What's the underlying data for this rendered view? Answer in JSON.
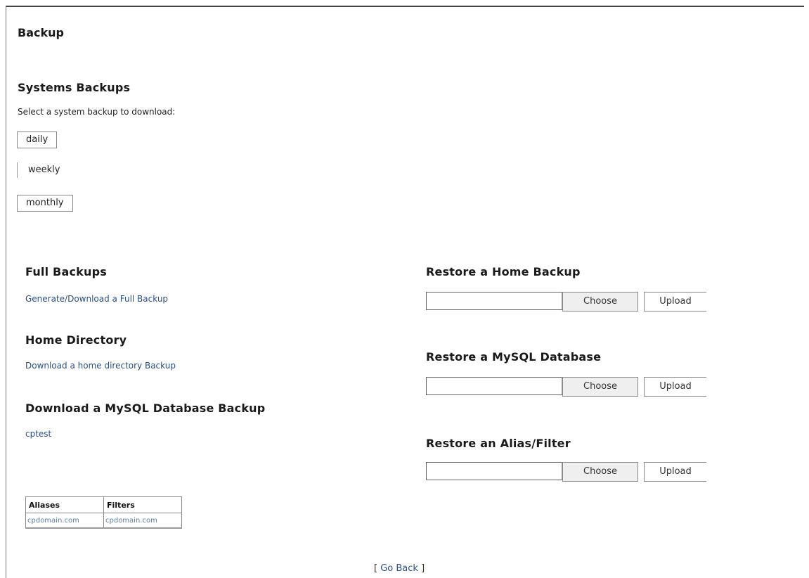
{
  "page": {
    "title": "Backup"
  },
  "systems": {
    "title": "Systems Backups",
    "instructions": "Select a system backup to download:",
    "buttons": [
      {
        "label": "daily"
      },
      {
        "label": "weekly"
      },
      {
        "label": "monthly"
      }
    ]
  },
  "full_backups": {
    "title": "Full Backups",
    "link": "Generate/Download a Full Backup"
  },
  "home_directory": {
    "title": "Home Directory",
    "link": "Download a home directory Backup"
  },
  "mysql_download": {
    "title": "Download a MySQL Database Backup",
    "databases": [
      "cptest"
    ]
  },
  "aliases_filters": {
    "headers": [
      "Aliases",
      "Filters"
    ],
    "row": [
      "cpdomain.com",
      "cpdomain.com"
    ]
  },
  "restore": [
    {
      "title": "Restore a Home Backup",
      "choose_label": "Choose",
      "upload_label": "Upload"
    },
    {
      "title": "Restore a MySQL Database",
      "choose_label": "Choose",
      "upload_label": "Upload"
    },
    {
      "title": "Restore an Alias/Filter",
      "choose_label": "Choose",
      "upload_label": "Upload"
    }
  ],
  "footer": {
    "open_bracket": "[",
    "go_back": "Go Back",
    "close_bracket": "]"
  }
}
